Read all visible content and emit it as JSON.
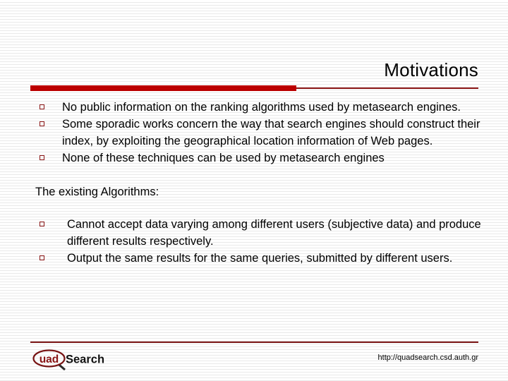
{
  "slide": {
    "title": "Motivations",
    "accent_color": "#c00000",
    "rule_line_color": "#8c1616",
    "bullet_marker_color": "#8c1616",
    "background_color": "#ffffff",
    "text_color": "#000000"
  },
  "content": {
    "group1": [
      "No public information on the ranking algorithms used by metasearch engines.",
      "Some sporadic works concern the way that search engines should construct their index, by exploiting the geographical location information of Web pages.",
      "None of these techniques can be used by metasearch engines"
    ],
    "subheading": "The existing Algorithms:",
    "group2": [
      "Cannot accept data varying among different users (subjective data) and produce different results respectively.",
      "Output the same results for the same queries, submitted by different users."
    ]
  },
  "footer": {
    "logo_mark_text": "uad",
    "logo_word_text": "Search",
    "logo_name": "quadSearch",
    "logo_color": "#8c1616",
    "url": "http://quadsearch.csd.auth.gr"
  }
}
